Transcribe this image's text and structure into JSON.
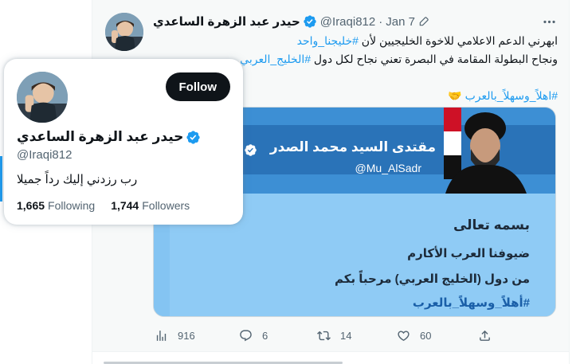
{
  "tweet": {
    "display_name": "حيدر عبد الزهرة الساعدي",
    "handle": "@Iraqi812",
    "separator": "·",
    "date": "Jan 7",
    "text_line1_prefix": "ابهرني الدعم الاعلامي للاخوة الخليجيين لأن ",
    "text_line1_tag": "#خليجنا_واحد",
    "text_line2_prefix": "ونجاح البطولة المقامة في البصرة تعني نجاح لكل دول ",
    "text_line2_tag": "#الخليج_العربي",
    "text_line3_tag": "#اهلاً_وسهلاً_بالعرب",
    "text_line3_emoji": "🤝",
    "media": {
      "name": "مقتدى السيد محمد الصدر",
      "handle": "@Mu_AlSadr",
      "line1": "بسمه تعالى",
      "line2": "ضيوفنا العرب الأكارم",
      "line3": "من دول (الخليج العربي) مرحباً بكم",
      "line4": "#أهلاً_وسهلاً_بالعرب"
    },
    "metrics": {
      "views": "916",
      "replies": "6",
      "retweets": "14",
      "likes": "60"
    },
    "icons": {
      "verified": "verified-badge-icon",
      "edit": "edit-pencil-icon",
      "more": "more-dots-icon",
      "views": "views-chart-icon",
      "reply": "reply-bubble-icon",
      "retweet": "retweet-icon",
      "like": "heart-icon",
      "share": "share-icon"
    }
  },
  "hovercard": {
    "display_name": "حيدر عبد الزهرة الساعدي",
    "handle": "@Iraqi812",
    "follow_label": "Follow",
    "bio": "رب رزدني إليك رداً جميلا",
    "following_count": "1,665",
    "following_label": "Following",
    "followers_count": "1,744",
    "followers_label": "Followers"
  },
  "colors": {
    "accent": "#1d9bf0",
    "text": "#0f1419",
    "muted": "#536471",
    "follow_button": "#0f1419"
  }
}
